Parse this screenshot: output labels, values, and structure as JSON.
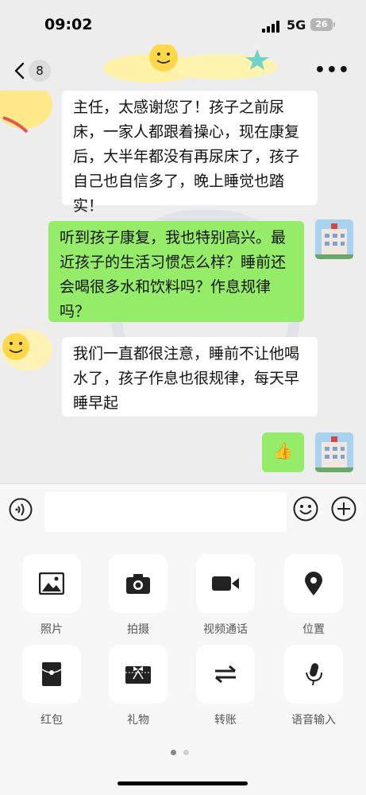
{
  "status": {
    "time": "09:02",
    "network": "5G",
    "battery": "26"
  },
  "nav": {
    "unread_count": "8"
  },
  "messages": [
    {
      "side": "in",
      "text": "主任，太感谢您了！孩子之前尿床，一家人都跟着操心，现在康复后，大半年都没有再尿床了，孩子自己也自信多了，晚上睡觉也踏实！"
    },
    {
      "side": "out",
      "text": "听到孩子康复，我也特别高兴。最近孩子的生活习惯怎么样？睡前还会喝很多水和饮料吗？作息规律吗？"
    },
    {
      "side": "in",
      "text": "我们一直都很注意，睡前不让他喝水了，孩子作息也很规律，每天早睡早起"
    },
    {
      "side": "out",
      "text": "👍"
    }
  ],
  "input": {
    "placeholder": ""
  },
  "panel": {
    "items": [
      {
        "label": "照片",
        "icon": "photo-icon"
      },
      {
        "label": "拍摄",
        "icon": "camera-icon"
      },
      {
        "label": "视频通话",
        "icon": "video-call-icon"
      },
      {
        "label": "位置",
        "icon": "location-icon"
      },
      {
        "label": "红包",
        "icon": "red-packet-icon"
      },
      {
        "label": "礼物",
        "icon": "gift-icon"
      },
      {
        "label": "转账",
        "icon": "transfer-icon"
      },
      {
        "label": "语音输入",
        "icon": "voice-input-icon"
      }
    ]
  },
  "colors": {
    "outgoing_bubble": "#95ec69",
    "incoming_bubble": "#ffffff",
    "background": "#ededed"
  }
}
